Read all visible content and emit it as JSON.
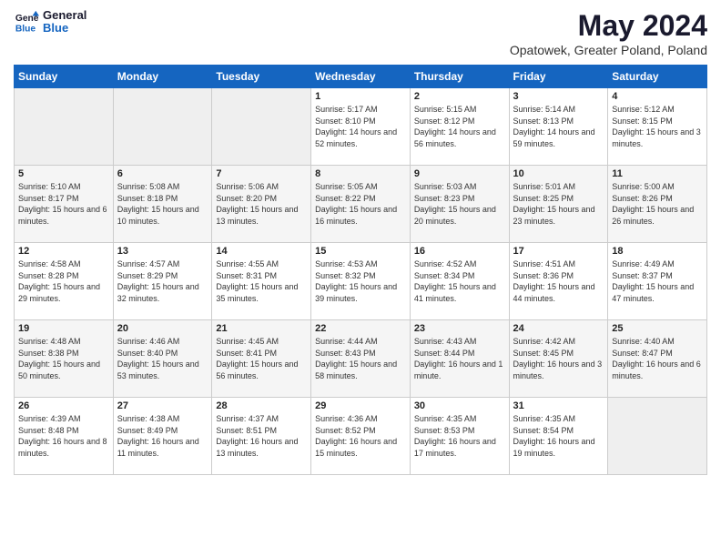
{
  "header": {
    "logo_line1": "General",
    "logo_line2": "Blue",
    "month_title": "May 2024",
    "location": "Opatowek, Greater Poland, Poland"
  },
  "days_of_week": [
    "Sunday",
    "Monday",
    "Tuesday",
    "Wednesday",
    "Thursday",
    "Friday",
    "Saturday"
  ],
  "weeks": [
    [
      {
        "day": "",
        "info": ""
      },
      {
        "day": "",
        "info": ""
      },
      {
        "day": "",
        "info": ""
      },
      {
        "day": "1",
        "info": "Sunrise: 5:17 AM\nSunset: 8:10 PM\nDaylight: 14 hours and 52 minutes."
      },
      {
        "day": "2",
        "info": "Sunrise: 5:15 AM\nSunset: 8:12 PM\nDaylight: 14 hours and 56 minutes."
      },
      {
        "day": "3",
        "info": "Sunrise: 5:14 AM\nSunset: 8:13 PM\nDaylight: 14 hours and 59 minutes."
      },
      {
        "day": "4",
        "info": "Sunrise: 5:12 AM\nSunset: 8:15 PM\nDaylight: 15 hours and 3 minutes."
      }
    ],
    [
      {
        "day": "5",
        "info": "Sunrise: 5:10 AM\nSunset: 8:17 PM\nDaylight: 15 hours and 6 minutes."
      },
      {
        "day": "6",
        "info": "Sunrise: 5:08 AM\nSunset: 8:18 PM\nDaylight: 15 hours and 10 minutes."
      },
      {
        "day": "7",
        "info": "Sunrise: 5:06 AM\nSunset: 8:20 PM\nDaylight: 15 hours and 13 minutes."
      },
      {
        "day": "8",
        "info": "Sunrise: 5:05 AM\nSunset: 8:22 PM\nDaylight: 15 hours and 16 minutes."
      },
      {
        "day": "9",
        "info": "Sunrise: 5:03 AM\nSunset: 8:23 PM\nDaylight: 15 hours and 20 minutes."
      },
      {
        "day": "10",
        "info": "Sunrise: 5:01 AM\nSunset: 8:25 PM\nDaylight: 15 hours and 23 minutes."
      },
      {
        "day": "11",
        "info": "Sunrise: 5:00 AM\nSunset: 8:26 PM\nDaylight: 15 hours and 26 minutes."
      }
    ],
    [
      {
        "day": "12",
        "info": "Sunrise: 4:58 AM\nSunset: 8:28 PM\nDaylight: 15 hours and 29 minutes."
      },
      {
        "day": "13",
        "info": "Sunrise: 4:57 AM\nSunset: 8:29 PM\nDaylight: 15 hours and 32 minutes."
      },
      {
        "day": "14",
        "info": "Sunrise: 4:55 AM\nSunset: 8:31 PM\nDaylight: 15 hours and 35 minutes."
      },
      {
        "day": "15",
        "info": "Sunrise: 4:53 AM\nSunset: 8:32 PM\nDaylight: 15 hours and 39 minutes."
      },
      {
        "day": "16",
        "info": "Sunrise: 4:52 AM\nSunset: 8:34 PM\nDaylight: 15 hours and 41 minutes."
      },
      {
        "day": "17",
        "info": "Sunrise: 4:51 AM\nSunset: 8:36 PM\nDaylight: 15 hours and 44 minutes."
      },
      {
        "day": "18",
        "info": "Sunrise: 4:49 AM\nSunset: 8:37 PM\nDaylight: 15 hours and 47 minutes."
      }
    ],
    [
      {
        "day": "19",
        "info": "Sunrise: 4:48 AM\nSunset: 8:38 PM\nDaylight: 15 hours and 50 minutes."
      },
      {
        "day": "20",
        "info": "Sunrise: 4:46 AM\nSunset: 8:40 PM\nDaylight: 15 hours and 53 minutes."
      },
      {
        "day": "21",
        "info": "Sunrise: 4:45 AM\nSunset: 8:41 PM\nDaylight: 15 hours and 56 minutes."
      },
      {
        "day": "22",
        "info": "Sunrise: 4:44 AM\nSunset: 8:43 PM\nDaylight: 15 hours and 58 minutes."
      },
      {
        "day": "23",
        "info": "Sunrise: 4:43 AM\nSunset: 8:44 PM\nDaylight: 16 hours and 1 minute."
      },
      {
        "day": "24",
        "info": "Sunrise: 4:42 AM\nSunset: 8:45 PM\nDaylight: 16 hours and 3 minutes."
      },
      {
        "day": "25",
        "info": "Sunrise: 4:40 AM\nSunset: 8:47 PM\nDaylight: 16 hours and 6 minutes."
      }
    ],
    [
      {
        "day": "26",
        "info": "Sunrise: 4:39 AM\nSunset: 8:48 PM\nDaylight: 16 hours and 8 minutes."
      },
      {
        "day": "27",
        "info": "Sunrise: 4:38 AM\nSunset: 8:49 PM\nDaylight: 16 hours and 11 minutes."
      },
      {
        "day": "28",
        "info": "Sunrise: 4:37 AM\nSunset: 8:51 PM\nDaylight: 16 hours and 13 minutes."
      },
      {
        "day": "29",
        "info": "Sunrise: 4:36 AM\nSunset: 8:52 PM\nDaylight: 16 hours and 15 minutes."
      },
      {
        "day": "30",
        "info": "Sunrise: 4:35 AM\nSunset: 8:53 PM\nDaylight: 16 hours and 17 minutes."
      },
      {
        "day": "31",
        "info": "Sunrise: 4:35 AM\nSunset: 8:54 PM\nDaylight: 16 hours and 19 minutes."
      },
      {
        "day": "",
        "info": ""
      }
    ]
  ],
  "colors": {
    "header_bg": "#1565c0",
    "header_text": "#ffffff",
    "logo_blue": "#1565c0"
  }
}
